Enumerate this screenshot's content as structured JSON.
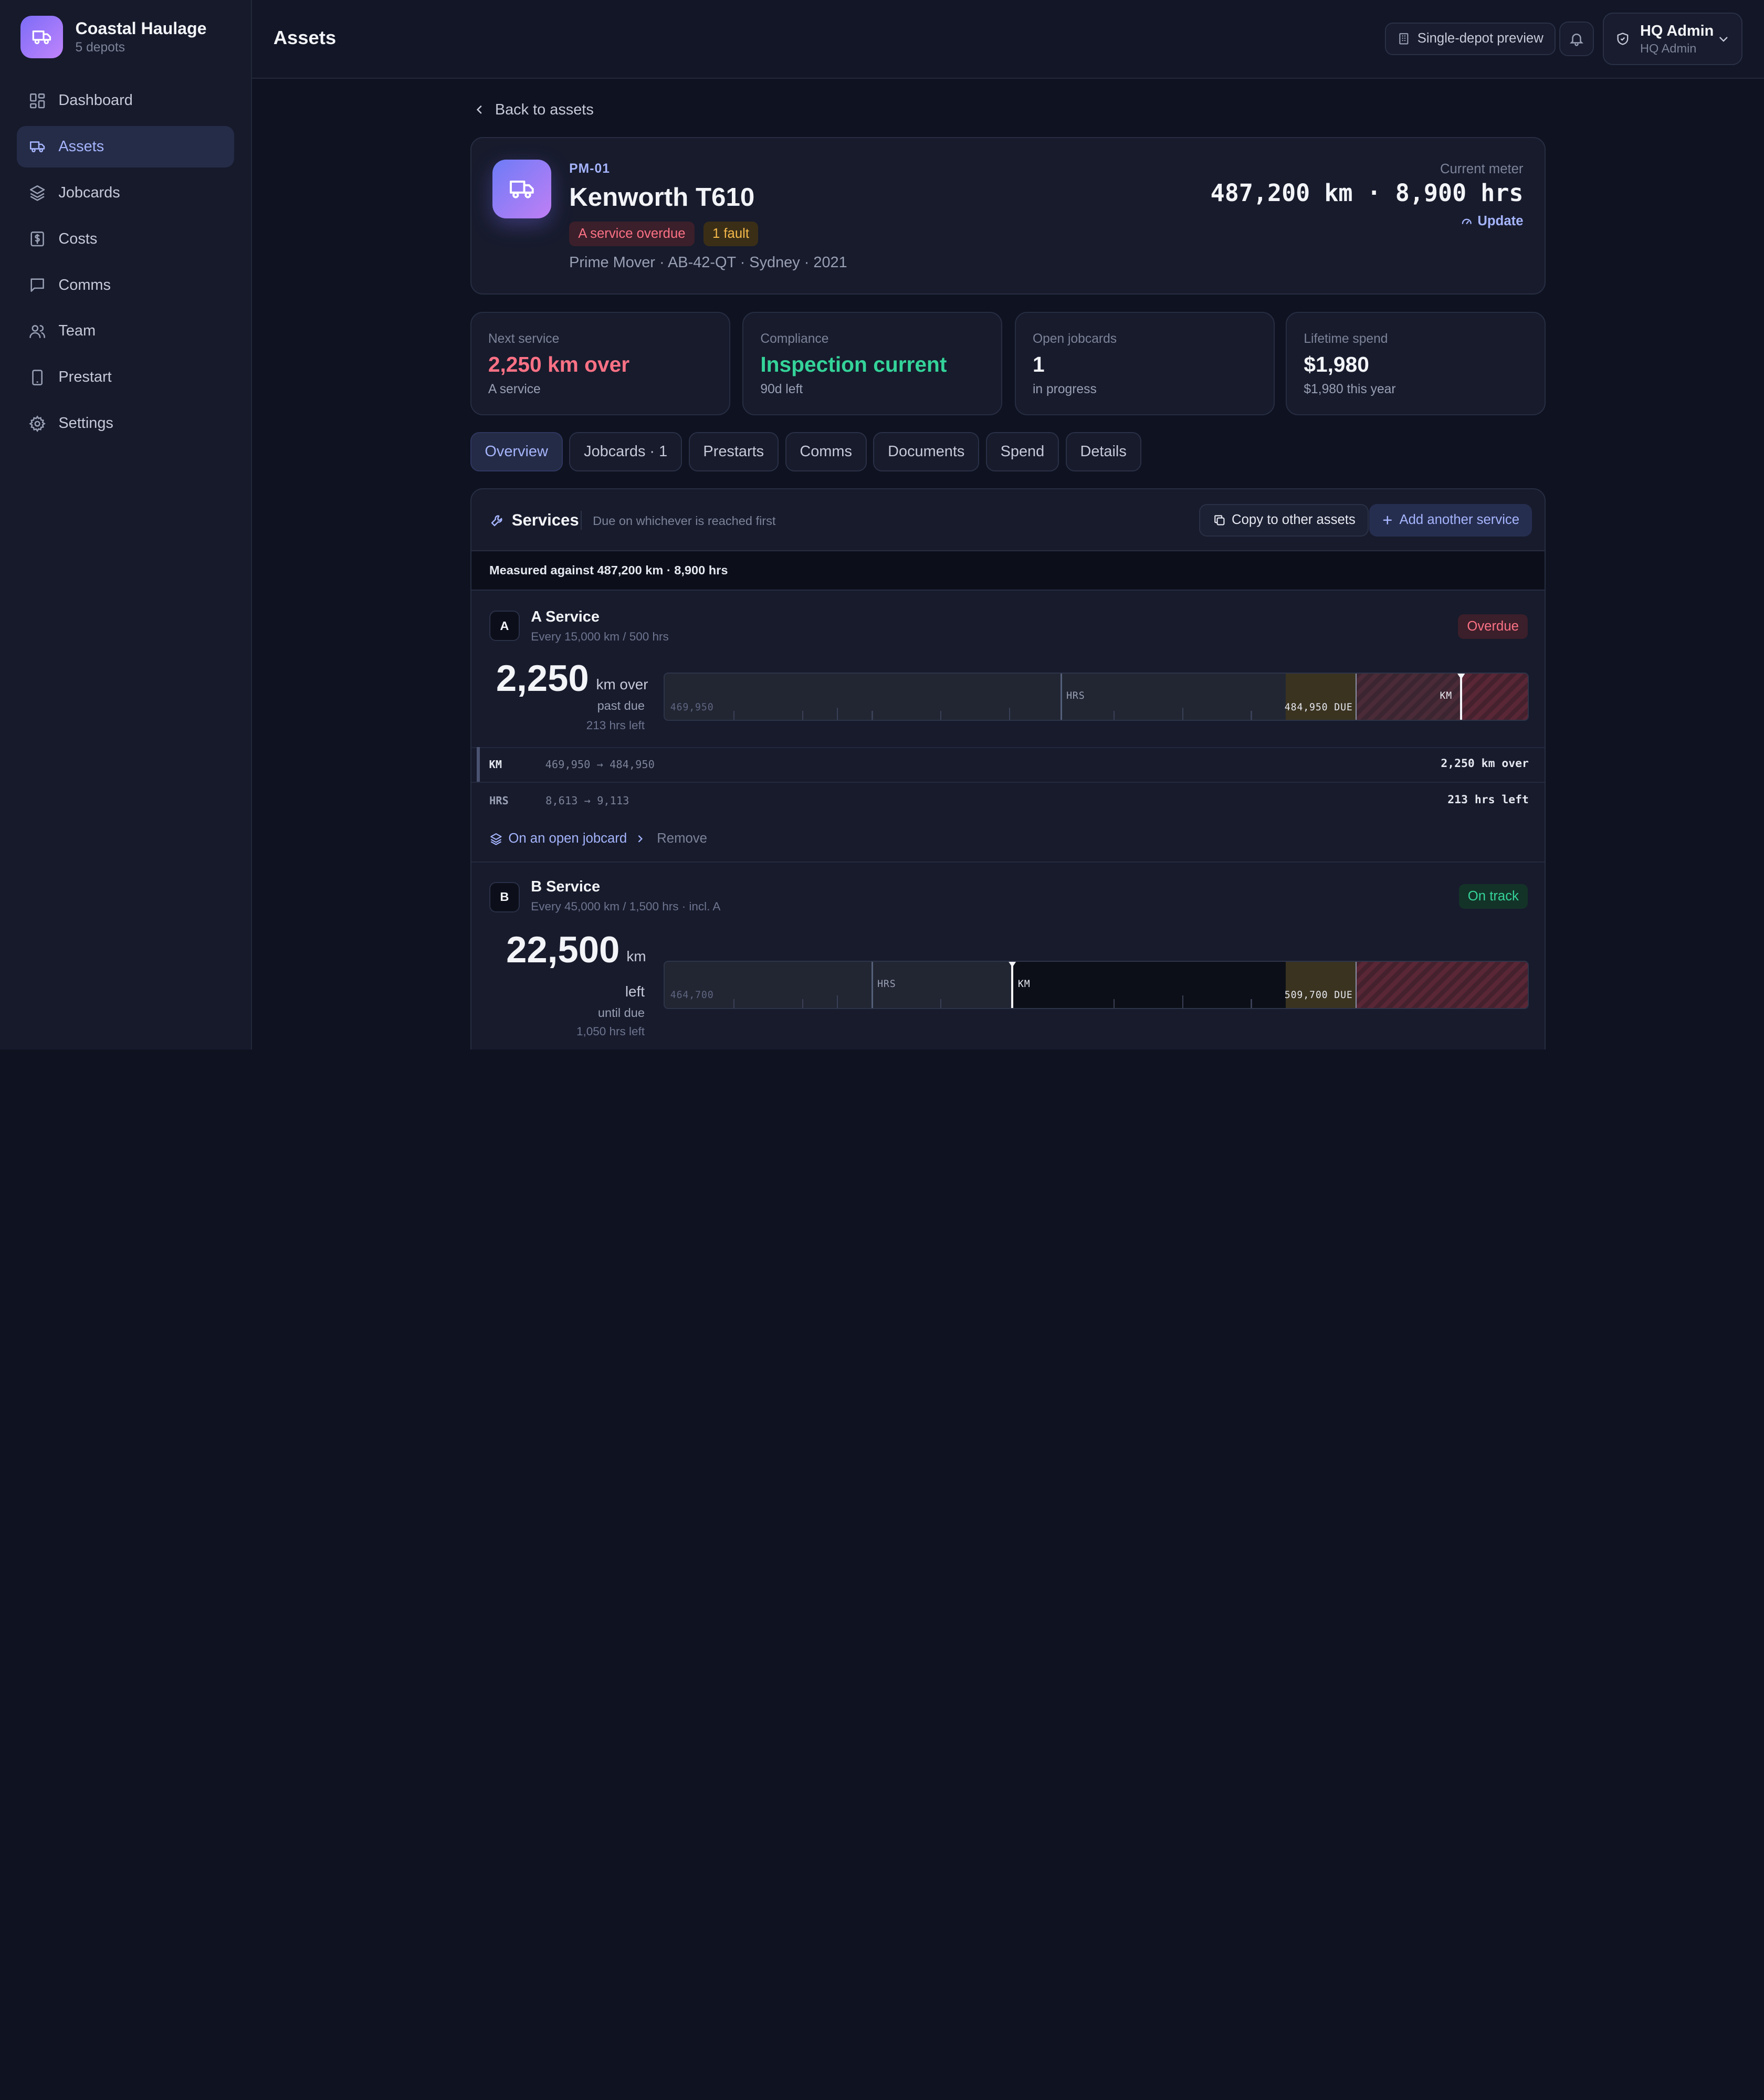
{
  "brand": {
    "name": "Coastal Haulage",
    "sub": "5 depots"
  },
  "nav": [
    {
      "id": "dashboard",
      "label": "Dashboard",
      "icon": "dashboard-icon"
    },
    {
      "id": "assets",
      "label": "Assets",
      "icon": "truck-icon",
      "active": true
    },
    {
      "id": "jobcards",
      "label": "Jobcards",
      "icon": "layers-icon"
    },
    {
      "id": "costs",
      "label": "Costs",
      "icon": "dollar-icon"
    },
    {
      "id": "comms",
      "label": "Comms",
      "icon": "chat-icon"
    },
    {
      "id": "team",
      "label": "Team",
      "icon": "users-icon"
    },
    {
      "id": "prestart",
      "label": "Prestart",
      "icon": "phone-icon"
    },
    {
      "id": "settings",
      "label": "Settings",
      "icon": "gear-icon"
    }
  ],
  "topbar": {
    "title": "Assets",
    "preview_label": "Single-depot preview",
    "user_name": "HQ Admin",
    "user_role": "HQ Admin"
  },
  "back_label": "Back to assets",
  "asset": {
    "code": "PM-01",
    "name": "Kenworth T610",
    "badges": [
      "A service overdue",
      "1 fault"
    ],
    "meta": "Prime Mover · AB-42-QT · Sydney · 2021",
    "meter_label": "Current meter",
    "meter_value": "487,200 km · 8,900 hrs",
    "update_label": "Update"
  },
  "stats": [
    {
      "label": "Next service",
      "value": "2,250 km over",
      "sub": "A service",
      "tone": "red"
    },
    {
      "label": "Compliance",
      "value": "Inspection current",
      "sub": "90d left",
      "tone": "green"
    },
    {
      "label": "Open jobcards",
      "value": "1",
      "sub": "in progress",
      "tone": "normal"
    },
    {
      "label": "Lifetime spend",
      "value": "$1,980",
      "sub": "$1,980 this year",
      "tone": "normal"
    }
  ],
  "tabs": [
    "Overview",
    "Jobcards · 1",
    "Prestarts",
    "Comms",
    "Documents",
    "Spend",
    "Details"
  ],
  "services_panel": {
    "title": "Services",
    "hint": "Due on whichever is reached first",
    "copy_label": "Copy to other assets",
    "add_label": "Add another service",
    "measured": "Measured against 487,200 km · 8,900 hrs"
  },
  "services": [
    {
      "letter": "A",
      "name": "A Service",
      "every": "Every 15,000 km / 500 hrs",
      "status": "Overdue",
      "big": "2,250",
      "unit": "km over",
      "sub1": "past due",
      "sub2": "213 hrs left",
      "track": {
        "start": "469,950",
        "hrs": "HRS",
        "due": "484,950 DUE",
        "km": "KM"
      },
      "rows": [
        {
          "key": "KM",
          "range": "469,950 → 484,950",
          "value": "2,250 km over"
        },
        {
          "key": "HRS",
          "range": "8,613 → 9,113",
          "value": "213 hrs left"
        }
      ],
      "jobcard_label": "On an open jobcard",
      "remove_label": "Remove"
    },
    {
      "letter": "B",
      "name": "B Service",
      "every": "Every 45,000 km / 1,500 hrs · incl. A",
      "status": "On track",
      "big": "22,500",
      "unit": "km",
      "sub0": "left",
      "sub1": "until due",
      "sub2": "1,050 hrs left",
      "track": {
        "start": "464,700",
        "hrs": "HRS",
        "due": "509,700 DUE",
        "km": "KM"
      }
    }
  ],
  "colors": {
    "accent": "#a5b4fc",
    "danger": "#fb7185",
    "success": "#34d399",
    "warning": "#f5b94a"
  }
}
